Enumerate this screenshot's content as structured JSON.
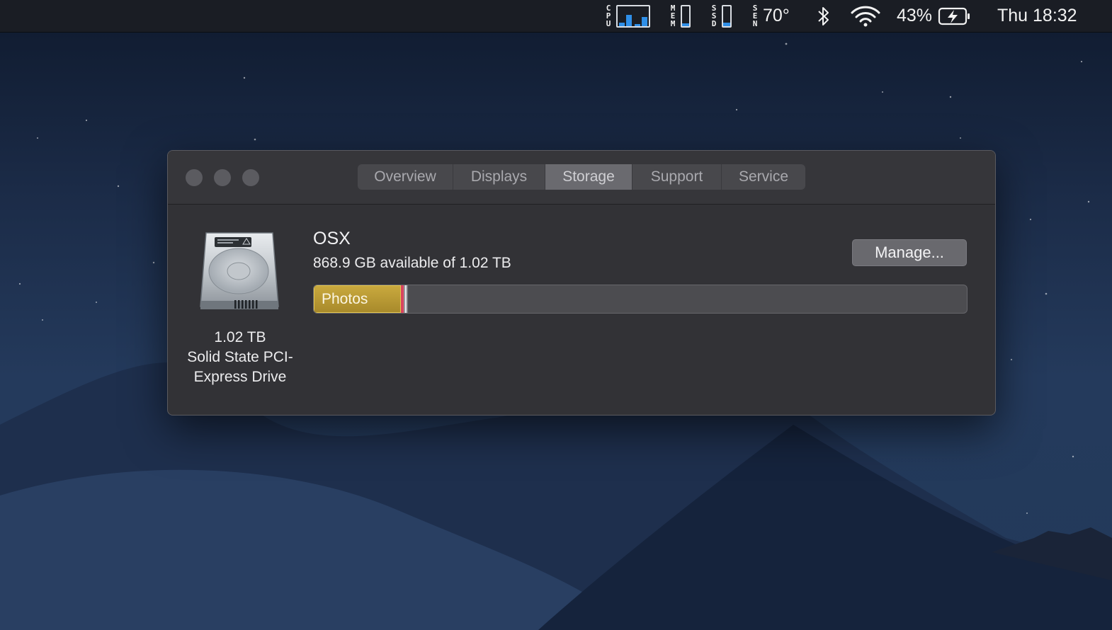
{
  "menubar": {
    "cpu_label": [
      "C",
      "P",
      "U"
    ],
    "mem_label": [
      "M",
      "E",
      "M"
    ],
    "ssd_label": [
      "S",
      "S",
      "D"
    ],
    "sen_label": [
      "S",
      "E",
      "N"
    ],
    "cpu_bars": [
      0.15,
      0.55,
      0.1,
      0.45
    ],
    "mem_level": 0.12,
    "ssd_level": 0.15,
    "temperature": "70°",
    "battery_percent": "43%",
    "clock": "Thu 18:32",
    "icons": [
      "bluetooth-icon",
      "wifi-icon",
      "battery-charging-icon"
    ]
  },
  "window": {
    "tabs": [
      {
        "label": "Overview",
        "active": false
      },
      {
        "label": "Displays",
        "active": false
      },
      {
        "label": "Storage",
        "active": true
      },
      {
        "label": "Support",
        "active": false
      },
      {
        "label": "Service",
        "active": false
      }
    ],
    "drive": {
      "capacity": "1.02 TB",
      "type_line1": "Solid State PCI-",
      "type_line2": "Express Drive"
    },
    "volume": {
      "name": "OSX",
      "available": "868.9 GB available of 1.02 TB"
    },
    "manage_label": "Manage...",
    "storage_bar": {
      "segments": [
        {
          "label": "Photos",
          "fraction": 0.133,
          "color": "#c9a93e"
        },
        {
          "label": "",
          "fraction": 0.005,
          "color": "#d9445e"
        },
        {
          "label": "",
          "fraction": 0.002,
          "color": "#9a9a9e"
        },
        {
          "label": "",
          "fraction": 0.002,
          "color": "#e8e8ea"
        },
        {
          "label": "",
          "fraction": 0.002,
          "color": "#7d7d82"
        }
      ]
    }
  },
  "colors": {
    "accent_blue": "#2f8fe8",
    "window_bg": "#323236",
    "menubar_bg": "#1a1d24"
  }
}
